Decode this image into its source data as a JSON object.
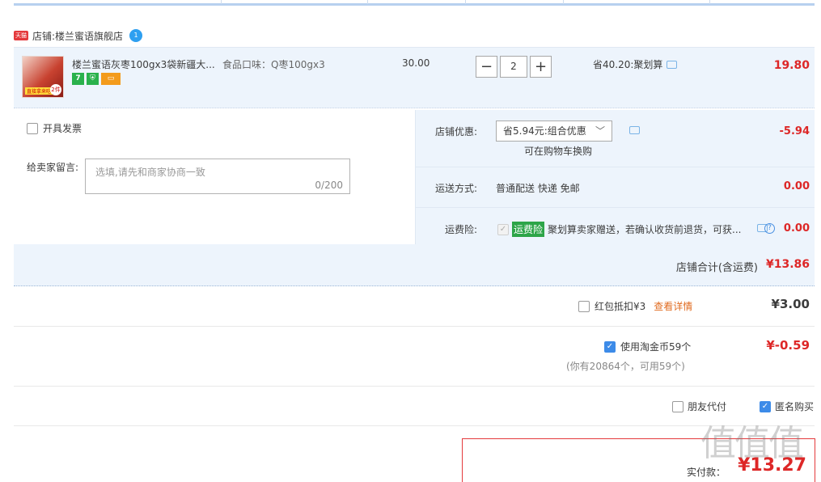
{
  "shop": {
    "tmall_icon": "天猫",
    "prefix": "店铺:",
    "name": "楼兰蜜语旗舰店",
    "wangwang_icon_text": "1"
  },
  "item": {
    "thumb_tag": "直接拿来吃",
    "thumb_badge": "2件",
    "title": "楼兰蜜语灰枣100gx3袋新疆大...",
    "service_icons": [
      "7",
      "shield-icon",
      "card-icon"
    ],
    "spec": "食品口味：Q枣100gx3",
    "unit_price": "30.00",
    "qty": {
      "minus": "−",
      "value": "2",
      "plus": "+"
    },
    "discount": "省40.20:聚划算",
    "subtotal": "19.80"
  },
  "options": {
    "invoice_label": "开具发票",
    "message_label": "给卖家留言:",
    "message_placeholder": "选填,请先和商家协商一致",
    "message_count": "0/200",
    "shop_discount_label": "店铺优惠:",
    "shop_discount_value": "省5.94元:组合优惠",
    "shop_discount_note": "可在购物车换购",
    "shop_discount_amount": "-5.94",
    "shipping_label": "运送方式:",
    "shipping_value": "普通配送 快递 免邮",
    "shipping_amount": "0.00",
    "insurance_label": "运费险:",
    "insurance_tag": "运费险",
    "insurance_text": "聚划算卖家赠送，若确认收货前退货，可获...",
    "insurance_amount": "0.00"
  },
  "shop_total": {
    "label": "店铺合计(含运费)",
    "value": "¥13.86"
  },
  "redpacket": {
    "label": "红包抵扣¥3",
    "link": "查看详情",
    "value": "¥3.00"
  },
  "coins": {
    "label": "使用淘金币59个",
    "note": "(你有20864个，可用59个)",
    "value": "¥-0.59"
  },
  "extras": {
    "friend_pay": "朋友代付",
    "anonymous": "匿名购买"
  },
  "payment": {
    "label": "实付款：",
    "value": "¥13.27"
  },
  "watermark": "值值值",
  "colors": {
    "accent_red": "#dd2727",
    "panel_blue": "#edf4fc",
    "check_blue": "#3d8be8",
    "tag_green": "#2da548"
  }
}
